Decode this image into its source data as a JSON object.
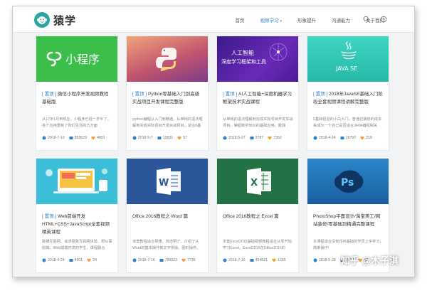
{
  "header": {
    "logo_text": "猿学",
    "nav": [
      {
        "label": "首页",
        "active": false
      },
      {
        "label": "视频学习",
        "active": true,
        "dropdown": true
      },
      {
        "label": "形象提升",
        "active": false
      },
      {
        "label": "沟通能力",
        "active": false
      },
      {
        "label": "关于我们",
        "active": false
      }
    ],
    "icons": [
      "search-icon",
      "clock-icon"
    ]
  },
  "cards": [
    {
      "tag": "[ 置顶 ]",
      "title": "微信小程序开发视频教程基础版",
      "desc": "从17年1月到现在，小程序已经一岁半了，各个应用重新了我们生活的方方面",
      "date": "2018-7-13",
      "views": "859629",
      "likes": "4801",
      "thumb": {
        "kind": "miniprogram",
        "text": "小程序",
        "bg": "#3bbf4a"
      }
    },
    {
      "tag": "[ 置顶 ]",
      "title": "Python零基础入门到高级实战项目开发课程完整版",
      "desc": "python编程从入门到精通，从单纯的语法理解到完成实际项目开发实战项目，适合0基础",
      "date": "2018-5-7",
      "views": "10601",
      "likes": "57",
      "thumb": {
        "kind": "python",
        "bg": "#c2556f"
      }
    },
    {
      "tag": "[ 置顶 ]",
      "title": "AI人工智能+深度机器学习框架技术实战课程",
      "desc": "从单纯的语法理解到完成实际项目开发实战项目，掌握数学知识的基础应用、数独",
      "date": "2018-5-27",
      "views": "3787",
      "likes": "7362",
      "thumb": {
        "kind": "ai",
        "line1": "人工智能",
        "line2": "深度学习框架和工具",
        "bg": "#5a2aa8"
      }
    },
    {
      "tag": "[ 置顶 ]",
      "title": "2018年JavaSE基础入门阶段全套视频课程讲解完整版",
      "desc": "0基础经验的小白入门，普通过最低的成本来成为一个自己是否适合JAVA编程相关",
      "date": "2018-4-24",
      "views": "16797",
      "likes": "219",
      "thumb": {
        "kind": "java",
        "text": "JAVA SE",
        "bg": "#2fc7b6"
      }
    },
    {
      "tag": "[ 置顶 ]",
      "title": "Web前端开发HTML+CSS+JavaScript全套视频精英课程",
      "desc": "跳槽互联网、追求极致互联网体验、想从事前端、Web前端开发的学生、课程融合",
      "date": "2018-4-24",
      "views": "4601",
      "likes": "24",
      "thumb": {
        "kind": "web",
        "bg": "#3bbfd9"
      }
    },
    {
      "tag": "",
      "title": "Office 2016教程之 Word 篇",
      "desc": "该套教程适合易懂、简洁明了、介绍了从Word的基本操作到文字排版、图形操作、",
      "date": "2018-7-16",
      "views": "789923",
      "likes": "7736",
      "thumb": {
        "kind": "word",
        "bg": "#2b579a"
      }
    },
    {
      "tag": "",
      "title": "Office 2016教程之 Excel 篇",
      "desc": "本套Excel2016基础视频教程适合从零开始学习Excel。Excel2016在Office2016的",
      "date": "2018-7-16",
      "views": "454821",
      "likes": "1265",
      "thumb": {
        "kind": "excel",
        "bg": "#217346"
      }
    },
    {
      "tag": "",
      "title": "PhotoShop平面设计/淘宝美工/网站装修/零基础到精通完整课程",
      "desc": "本课程适合没有任何基础的学员上手学习，简单操作!",
      "date": "2018-5-28",
      "views": "2873",
      "likes": "43",
      "thumb": {
        "kind": "ps",
        "bg": "#1f6fb3"
      }
    }
  ],
  "watermark": "知乎 @木子淇",
  "colors": {
    "accent": "#2a7fd1",
    "logo": "#2aa6a1"
  }
}
